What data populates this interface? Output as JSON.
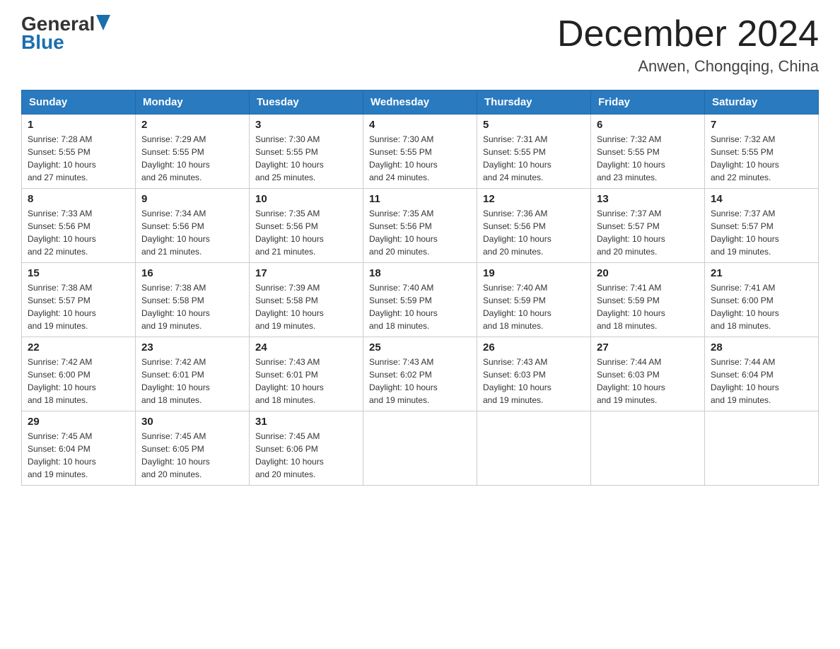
{
  "logo": {
    "general": "General",
    "blue": "Blue"
  },
  "title": "December 2024",
  "subtitle": "Anwen, Chongqing, China",
  "weekdays": [
    "Sunday",
    "Monday",
    "Tuesday",
    "Wednesday",
    "Thursday",
    "Friday",
    "Saturday"
  ],
  "weeks": [
    [
      {
        "day": "1",
        "sunrise": "7:28 AM",
        "sunset": "5:55 PM",
        "daylight": "10 hours and 27 minutes."
      },
      {
        "day": "2",
        "sunrise": "7:29 AM",
        "sunset": "5:55 PM",
        "daylight": "10 hours and 26 minutes."
      },
      {
        "day": "3",
        "sunrise": "7:30 AM",
        "sunset": "5:55 PM",
        "daylight": "10 hours and 25 minutes."
      },
      {
        "day": "4",
        "sunrise": "7:30 AM",
        "sunset": "5:55 PM",
        "daylight": "10 hours and 24 minutes."
      },
      {
        "day": "5",
        "sunrise": "7:31 AM",
        "sunset": "5:55 PM",
        "daylight": "10 hours and 24 minutes."
      },
      {
        "day": "6",
        "sunrise": "7:32 AM",
        "sunset": "5:55 PM",
        "daylight": "10 hours and 23 minutes."
      },
      {
        "day": "7",
        "sunrise": "7:32 AM",
        "sunset": "5:55 PM",
        "daylight": "10 hours and 22 minutes."
      }
    ],
    [
      {
        "day": "8",
        "sunrise": "7:33 AM",
        "sunset": "5:56 PM",
        "daylight": "10 hours and 22 minutes."
      },
      {
        "day": "9",
        "sunrise": "7:34 AM",
        "sunset": "5:56 PM",
        "daylight": "10 hours and 21 minutes."
      },
      {
        "day": "10",
        "sunrise": "7:35 AM",
        "sunset": "5:56 PM",
        "daylight": "10 hours and 21 minutes."
      },
      {
        "day": "11",
        "sunrise": "7:35 AM",
        "sunset": "5:56 PM",
        "daylight": "10 hours and 20 minutes."
      },
      {
        "day": "12",
        "sunrise": "7:36 AM",
        "sunset": "5:56 PM",
        "daylight": "10 hours and 20 minutes."
      },
      {
        "day": "13",
        "sunrise": "7:37 AM",
        "sunset": "5:57 PM",
        "daylight": "10 hours and 20 minutes."
      },
      {
        "day": "14",
        "sunrise": "7:37 AM",
        "sunset": "5:57 PM",
        "daylight": "10 hours and 19 minutes."
      }
    ],
    [
      {
        "day": "15",
        "sunrise": "7:38 AM",
        "sunset": "5:57 PM",
        "daylight": "10 hours and 19 minutes."
      },
      {
        "day": "16",
        "sunrise": "7:38 AM",
        "sunset": "5:58 PM",
        "daylight": "10 hours and 19 minutes."
      },
      {
        "day": "17",
        "sunrise": "7:39 AM",
        "sunset": "5:58 PM",
        "daylight": "10 hours and 19 minutes."
      },
      {
        "day": "18",
        "sunrise": "7:40 AM",
        "sunset": "5:59 PM",
        "daylight": "10 hours and 18 minutes."
      },
      {
        "day": "19",
        "sunrise": "7:40 AM",
        "sunset": "5:59 PM",
        "daylight": "10 hours and 18 minutes."
      },
      {
        "day": "20",
        "sunrise": "7:41 AM",
        "sunset": "5:59 PM",
        "daylight": "10 hours and 18 minutes."
      },
      {
        "day": "21",
        "sunrise": "7:41 AM",
        "sunset": "6:00 PM",
        "daylight": "10 hours and 18 minutes."
      }
    ],
    [
      {
        "day": "22",
        "sunrise": "7:42 AM",
        "sunset": "6:00 PM",
        "daylight": "10 hours and 18 minutes."
      },
      {
        "day": "23",
        "sunrise": "7:42 AM",
        "sunset": "6:01 PM",
        "daylight": "10 hours and 18 minutes."
      },
      {
        "day": "24",
        "sunrise": "7:43 AM",
        "sunset": "6:01 PM",
        "daylight": "10 hours and 18 minutes."
      },
      {
        "day": "25",
        "sunrise": "7:43 AM",
        "sunset": "6:02 PM",
        "daylight": "10 hours and 19 minutes."
      },
      {
        "day": "26",
        "sunrise": "7:43 AM",
        "sunset": "6:03 PM",
        "daylight": "10 hours and 19 minutes."
      },
      {
        "day": "27",
        "sunrise": "7:44 AM",
        "sunset": "6:03 PM",
        "daylight": "10 hours and 19 minutes."
      },
      {
        "day": "28",
        "sunrise": "7:44 AM",
        "sunset": "6:04 PM",
        "daylight": "10 hours and 19 minutes."
      }
    ],
    [
      {
        "day": "29",
        "sunrise": "7:45 AM",
        "sunset": "6:04 PM",
        "daylight": "10 hours and 19 minutes."
      },
      {
        "day": "30",
        "sunrise": "7:45 AM",
        "sunset": "6:05 PM",
        "daylight": "10 hours and 20 minutes."
      },
      {
        "day": "31",
        "sunrise": "7:45 AM",
        "sunset": "6:06 PM",
        "daylight": "10 hours and 20 minutes."
      },
      null,
      null,
      null,
      null
    ]
  ],
  "labels": {
    "sunrise": "Sunrise:",
    "sunset": "Sunset:",
    "daylight": "Daylight:"
  }
}
